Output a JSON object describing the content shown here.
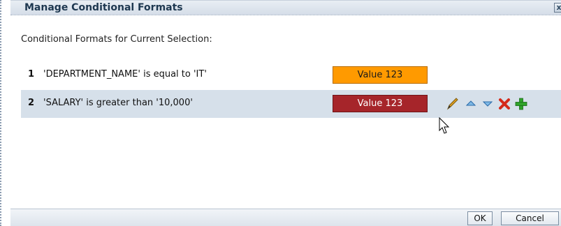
{
  "dialog": {
    "title": "Manage Conditional Formats",
    "close_label": "x",
    "subtitle": "Conditional Formats for Current Selection:",
    "rows": [
      {
        "num": "1",
        "condition": "'DEPARTMENT_NAME' is equal to 'IT'",
        "preview": "Value 123",
        "preview_bg": "#ff9a00",
        "preview_fg": "#1a1a1a"
      },
      {
        "num": "2",
        "condition": "'SALARY' is greater than '10,000'",
        "preview": "Value 123",
        "preview_bg": "#a6252a",
        "preview_fg": "#ffffff",
        "selected": true
      }
    ],
    "row_actions": [
      "edit-icon",
      "move-up-icon",
      "move-down-icon",
      "delete-icon",
      "add-icon"
    ],
    "footer": {
      "ok_label": "OK",
      "cancel_label": "Cancel"
    }
  }
}
